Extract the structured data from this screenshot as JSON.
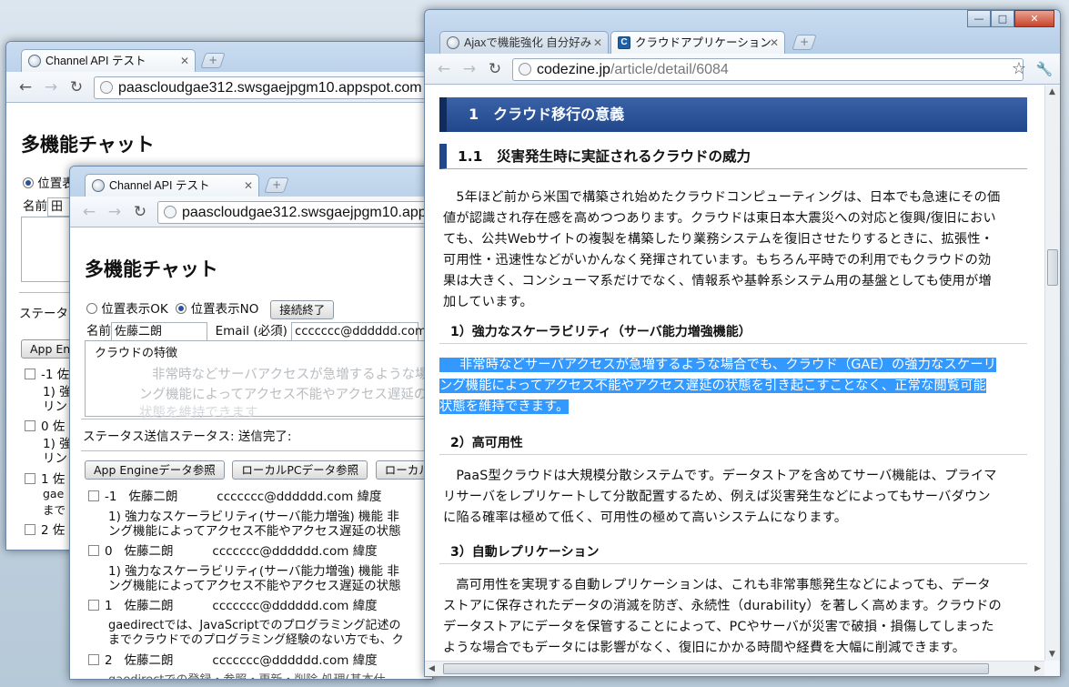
{
  "window_back": {
    "tab_title": "Channel API テスト",
    "url": "paascloudgae312.swsgaejpgm10.appspot.com",
    "heading": "多機能チャット",
    "radio_ok": "位置表",
    "name_label": "名前",
    "name_value": "田",
    "status_label": "ステータ",
    "button_app": "App Engi",
    "rows": [
      {
        "check": "-1",
        "text": "佐",
        "l1": "1) 強",
        "l2": "リン"
      },
      {
        "check": "0",
        "text": "佐",
        "l1": "1) 強",
        "l2": "リン"
      },
      {
        "check": "1",
        "text": "佐",
        "l1": "gae",
        "l2": "まで"
      },
      {
        "check": "2",
        "text": "佐"
      }
    ]
  },
  "window_mid": {
    "tab_title": "Channel API テスト",
    "url": "paascloudgae312.swsgaejpgm10.app",
    "heading": "多機能チャット",
    "radio_ok": "位置表示OK",
    "radio_no": "位置表示NO",
    "disconnect_button": "接続終了",
    "name_label": "名前",
    "name_value": "佐藤二朗",
    "email_label": "Email (必須)",
    "email_value": "ccccccc@dddddd.com",
    "textarea_text": "クラウドの特徴",
    "ghost_line1": "非常時などサーバアクセスが急増するような場合",
    "ghost_line2": "ング機能によってアクセス不能やアクセス遅延の",
    "ghost_line3": "状態を維持できます",
    "status_text": "ステータス送信ステータス:  送信完了:",
    "buttons": [
      "App Engineデータ参照",
      "ローカルPCデータ参照",
      "ローカル"
    ],
    "messages": [
      {
        "idx": "-1",
        "name": "佐藤二朗",
        "email": "ccccccc@dddddd.com",
        "tail": "緯度",
        "l1": "1) 強力なスケーラビリティ(サーバ能力増強) 機能 非",
        "l2": "ング機能によってアクセス不能やアクセス遅延の状態"
      },
      {
        "idx": "0",
        "name": "佐藤二朗",
        "email": "ccccccc@dddddd.com",
        "tail": "緯度",
        "l1": "1) 強力なスケーラビリティ(サーバ能力増強) 機能 非",
        "l2": "ング機能によってアクセス不能やアクセス遅延の状態"
      },
      {
        "idx": "1",
        "name": "佐藤二朗",
        "email": "ccccccc@dddddd.com",
        "tail": "緯度",
        "l1": "gaedirectでは、JavaScriptでのプログラミング記述の",
        "l2": "までクラウドでのプログラミング経験のない方でも、ク"
      },
      {
        "idx": "2",
        "name": "佐藤二朗",
        "email": "ccccccc@dddddd.com",
        "tail": "緯度",
        "l1": "gaedirectでの登録・参照・更新・削除  処理(基本仕"
      }
    ]
  },
  "window_front": {
    "tab1_title": "Ajaxで機能強化 自分好み",
    "tab2_title": "クラウドアプリケーション",
    "url_host": "codezine.jp",
    "url_path": "/article/detail/6084",
    "h2": "1　クラウド移行の意義",
    "h3": "1.1　災害発生時に実証されるクラウドの威力",
    "intro_paragraph": [
      "　5年ほど前から米国で構築され始めたクラウドコンピューティングは、日本でも急速にその価",
      "値が認識され存在感を高めつつあります。クラウドは東日本大震災への対応と復興/復旧におい",
      "ても、公共Webサイトの複製を構築したり業務システムを復旧させたりするときに、拡張性・",
      "可用性・迅速性などがいかんなく発揮されています。もちろん平時での利用でもクラウドの効",
      "果は大きく、コンシューマ系だけでなく、情報系や基幹系システム用の基盤としても使用が増",
      "加しています。"
    ],
    "h4_1": "1）強力なスケーラビリティ（サーバ能力増強機能）",
    "selected_paragraph": [
      "非常時などサーバアクセスが急増するような場合でも、クラウド（GAE）の強力なスケーリ",
      "ング機能によってアクセス不能やアクセス遅延の状態を引き起こすことなく、正常な閲覧可能",
      "状態を維持できます。"
    ],
    "h4_2": "2）高可用性",
    "availability_paragraph": [
      "　PaaS型クラウドは大規模分散システムです。データストアを含めてサーバ機能は、プライマ",
      "リサーバをレプリケートして分散配置するため、例えば災害発生などによってもサーバダウン",
      "に陥る確率は極めて低く、可用性の極めて高いシステムになります。"
    ],
    "h4_3": "3）自動レプリケーション",
    "replication_paragraph": [
      "　高可用性を実現する自動レプリケーションは、これも非常事態発生などによっても、データ",
      "ストアに保存されたデータの消滅を防ぎ、永続性（durability）を著しく高めます。クラウドの",
      "データストアにデータを保管することによって、PCやサーバが災害で破損・損傷してしまった",
      "ような場合でもデータには影響がなく、復旧にかかる時間や経費を大幅に削減できます。"
    ]
  }
}
